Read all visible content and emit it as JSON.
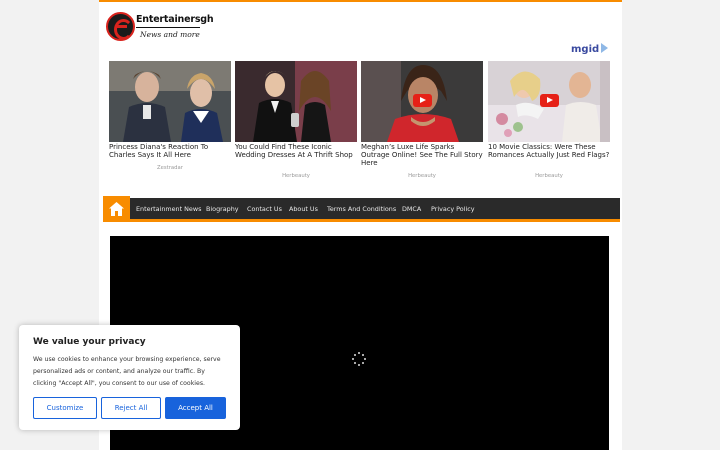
{
  "site": {
    "name": "Entertainersgh",
    "tagline": "News and more"
  },
  "ad_network": {
    "label": "mgid"
  },
  "ads": [
    {
      "title": "Princess Diana's Reaction To Charles Says It All Here",
      "source": "Zestradar",
      "has_video_icon": false
    },
    {
      "title": "You Could Find These Iconic Wedding Dresses At A Thrift Shop",
      "source": "Herbeauty",
      "has_video_icon": false
    },
    {
      "title": "Meghan’s Luxe Life Sparks Outrage Online! See The Full Story Here",
      "source": "Herbeauty",
      "has_video_icon": true
    },
    {
      "title": "10 Movie Classics: Were These Romances Actually Just Red Flags?",
      "source": "Herbeauty",
      "has_video_icon": true
    }
  ],
  "nav": {
    "items": [
      "Entertainment News",
      "Biography",
      "Contact Us",
      "About Us",
      "Terms And Conditions",
      "DMCA",
      "Privacy Policy"
    ]
  },
  "consent": {
    "title": "We value your privacy",
    "text": "We use cookies to enhance your browsing experience, serve personalized ads or content, and analyze our traffic. By clicking \"Accept All\", you consent to our use of cookies.",
    "customize_label": "Customize",
    "reject_label": "Reject All",
    "accept_label": "Accept All"
  },
  "colors": {
    "accent": "#f88c00",
    "nav_bg": "#2a2a2a",
    "consent_blue": "#1863dc"
  }
}
